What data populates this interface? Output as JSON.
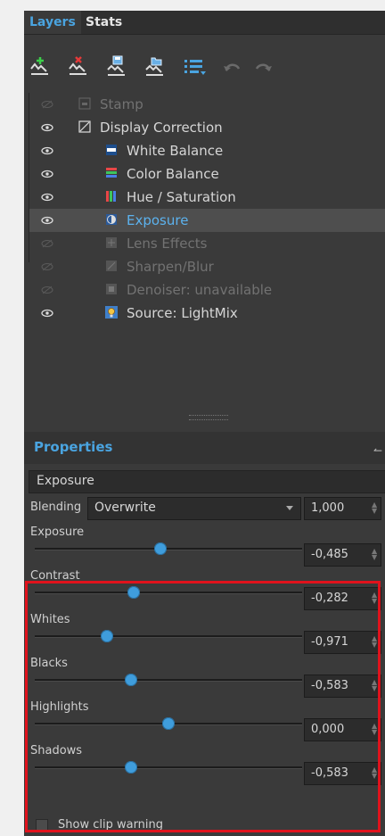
{
  "tabs": [
    {
      "label": "Layers",
      "active": true
    },
    {
      "label": "Stats",
      "active": false
    }
  ],
  "toolbar": {
    "icons": [
      "add-layer-icon",
      "delete-layer-icon",
      "save-layer-icon",
      "load-layer-icon",
      "layer-menu-icon",
      "undo-icon",
      "redo-icon"
    ]
  },
  "layers": [
    {
      "name": "Stamp",
      "visible": false,
      "enabled": false,
      "indent": 0,
      "icon": "stamp-icon"
    },
    {
      "name": "Display Correction",
      "visible": true,
      "enabled": true,
      "indent": 0,
      "icon": "curve-icon"
    },
    {
      "name": "White Balance",
      "visible": true,
      "enabled": true,
      "indent": 1,
      "icon": "white-balance-icon"
    },
    {
      "name": "Color Balance",
      "visible": true,
      "enabled": true,
      "indent": 1,
      "icon": "color-balance-icon"
    },
    {
      "name": "Hue / Saturation",
      "visible": true,
      "enabled": true,
      "indent": 1,
      "icon": "hue-saturation-icon"
    },
    {
      "name": "Exposure",
      "visible": true,
      "enabled": true,
      "indent": 1,
      "selected": true,
      "icon": "exposure-icon"
    },
    {
      "name": "Lens Effects",
      "visible": false,
      "enabled": false,
      "indent": 1,
      "icon": "lens-effects-icon"
    },
    {
      "name": "Sharpen/Blur",
      "visible": false,
      "enabled": false,
      "indent": 1,
      "icon": "sharpen-icon"
    },
    {
      "name": "Denoiser: unavailable",
      "visible": false,
      "enabled": false,
      "indent": 1,
      "icon": "denoiser-icon"
    },
    {
      "name": "Source: LightMix",
      "visible": true,
      "enabled": true,
      "indent": 1,
      "icon": "lightmix-icon"
    }
  ],
  "properties": {
    "title": "Properties",
    "selected_layer": "Exposure",
    "blending": {
      "label": "Blending",
      "mode": "Overwrite",
      "opacity": "1,000"
    },
    "params": [
      {
        "label": "Exposure",
        "value": "-0,485",
        "level": 0.47
      },
      {
        "label": "Contrast",
        "value": "-0,282",
        "level": 0.37
      },
      {
        "label": "Whites",
        "value": "-0,971",
        "level": 0.27
      },
      {
        "label": "Blacks",
        "value": "-0,583",
        "level": 0.36
      },
      {
        "label": "Highlights",
        "value": "0,000",
        "level": 0.5
      },
      {
        "label": "Shadows",
        "value": "-0,583",
        "level": 0.36
      }
    ],
    "show_clip_warning": {
      "label": "Show clip warning",
      "checked": false
    }
  },
  "colors": {
    "accent": "#4aa4e0",
    "panel": "#3a3a3a",
    "highlight_border": "#e0121c"
  }
}
